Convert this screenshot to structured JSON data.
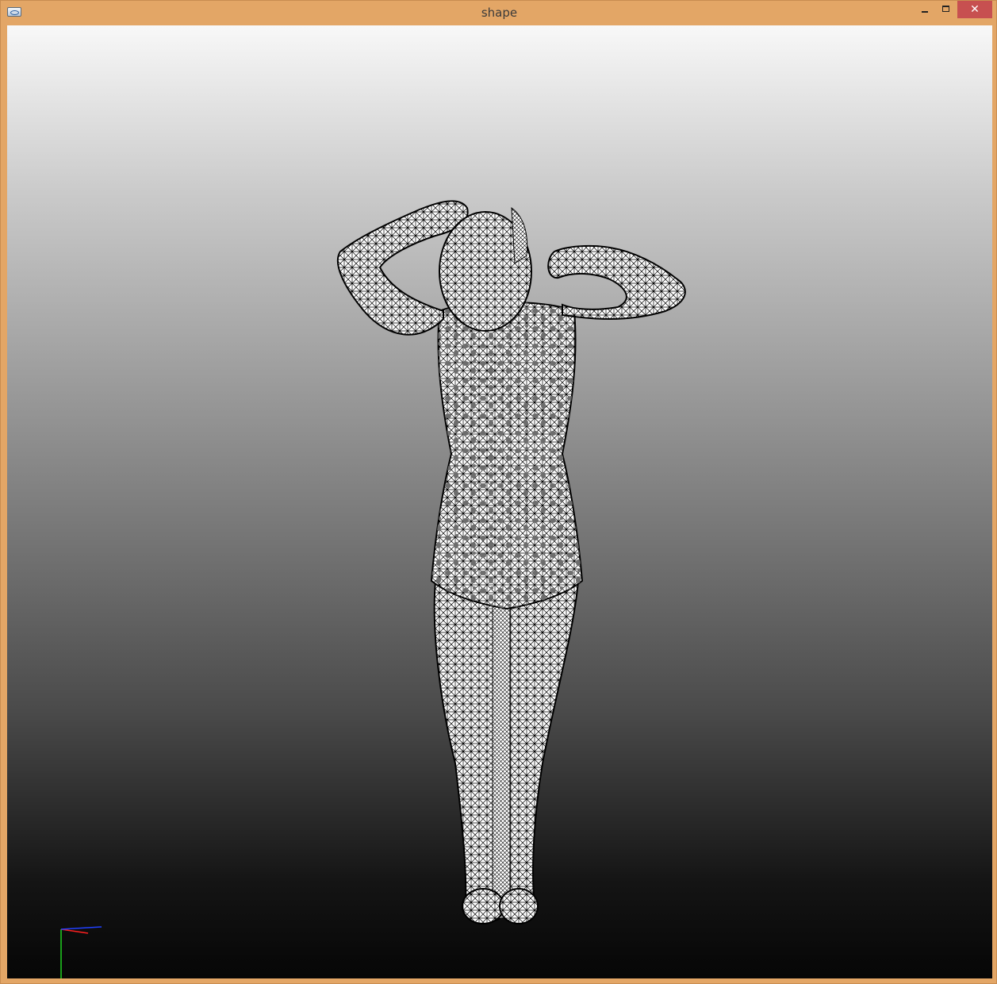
{
  "window": {
    "title": "shape",
    "frame_color": "#e3a666",
    "close_color": "#c75050"
  },
  "titlebar": {
    "app_icon": "app-icon",
    "minimize_icon": "minimize-icon",
    "maximize_icon": "maximize-icon",
    "close_icon": "close-icon",
    "close_glyph": "✕"
  },
  "viewport": {
    "background_top": "#f8f8f8",
    "background_bottom": "#060606",
    "mesh_fill": "#ffffff",
    "mesh_stroke": "#000000",
    "axis_colors": {
      "x": "#ff2020",
      "y": "#20d020",
      "z": "#2040ff"
    }
  }
}
